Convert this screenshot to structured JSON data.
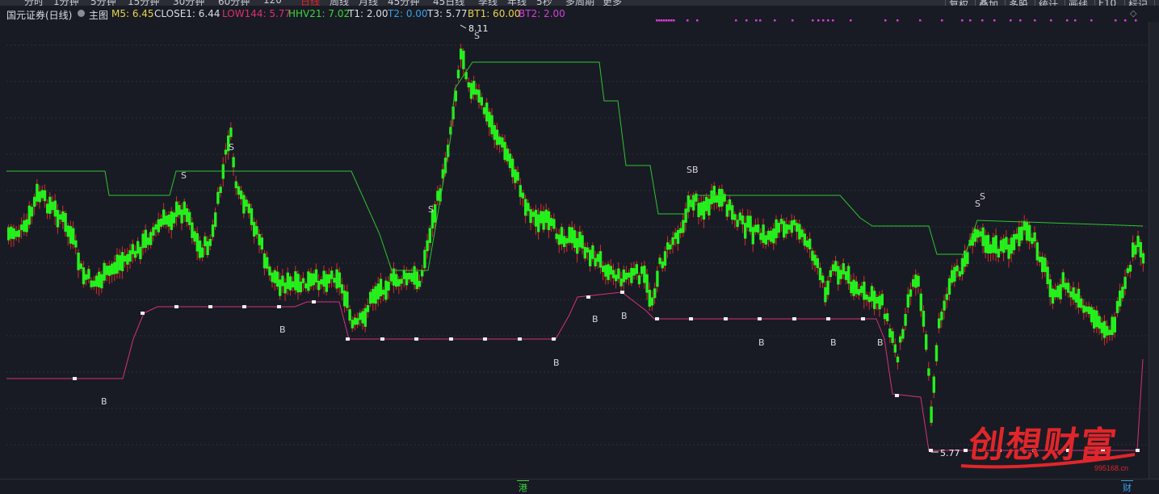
{
  "topbar": {
    "periods": [
      "分时",
      "1分钟",
      "5分钟",
      "15分钟",
      "30分钟",
      "60分钟",
      "120",
      "日线",
      "周线",
      "月线",
      "45分钟",
      "45日线",
      "季线",
      "年线",
      "5秒",
      "多周期",
      "更多"
    ],
    "right_buttons": [
      "复权",
      "叠加",
      "多股",
      "统计",
      "画线",
      "F10",
      "标记",
      "自选"
    ]
  },
  "header": {
    "stock_name": "国元证券(日线)",
    "main_label": "主图",
    "indicators": [
      {
        "label": "M5: 6.45",
        "color": "#e8d24a"
      },
      {
        "label": "CLOSE1: 6.44",
        "color": "#dadde4"
      },
      {
        "label": "LOW144: 5.77",
        "color": "#e0306e"
      },
      {
        "label": "HHV21: 7.02",
        "color": "#3ed63e"
      },
      {
        "label": "T1: 2.00",
        "color": "#dadde4"
      },
      {
        "label": "T2: 0.00",
        "color": "#3aa0e6"
      },
      {
        "label": "T3: 5.77",
        "color": "#dadde4"
      },
      {
        "label": "BT1: 60.00",
        "color": "#e8d24a"
      },
      {
        "label": "BT2: 2.00",
        "color": "#d83ed8"
      }
    ]
  },
  "price_labels": {
    "high": "8.11",
    "low": "5.77"
  },
  "signals": {
    "sell": "S",
    "buy": "B",
    "sell_buy": "SB"
  },
  "bottom_tags": {
    "left": "港",
    "right": "财"
  },
  "watermark": {
    "text": "创想财富",
    "url": "995168.cn"
  },
  "colors": {
    "background": "#181b24",
    "candle_up": "#24f01c",
    "wick": "#d82d2d",
    "hhv21_line": "#2fc42f",
    "low144_line": "#d8307a",
    "signal_text": "#d7d7d7",
    "magenta_dots": "#d83ed8"
  }
}
